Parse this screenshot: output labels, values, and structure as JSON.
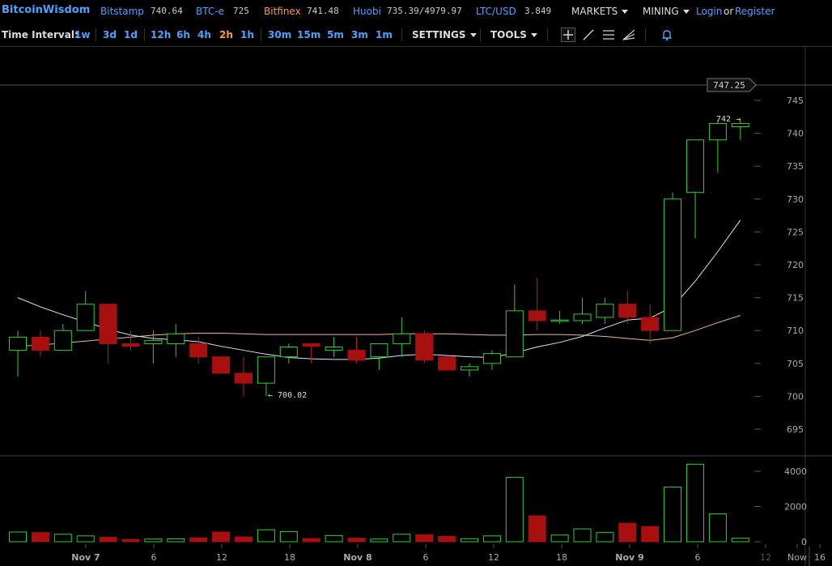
{
  "header": {
    "brand": "BitcoinWisdom",
    "tickers": [
      {
        "name": "Bitstamp",
        "value": "740.64",
        "color": "#4aa3ff"
      },
      {
        "name": "BTC-e",
        "value": "725",
        "color": "#4aa3ff"
      },
      {
        "name": "Bitfinex",
        "value": "741.48",
        "color": "#ff9a3c"
      },
      {
        "name": "Huobi",
        "value": "735.39/4979.97",
        "color": "#4aa3ff"
      },
      {
        "name": "LTC/USD",
        "value": "3.849",
        "color": "#4aa3ff"
      }
    ],
    "markets_label": "MARKETS",
    "mining_label": "MINING",
    "login_label": "Login",
    "or_label": "or",
    "register_label": "Register"
  },
  "toolbar": {
    "time_interval_label": "Time Interval:",
    "intervals": [
      "1w",
      "3d",
      "1d",
      "12h",
      "6h",
      "4h",
      "2h",
      "1h",
      "30m",
      "15m",
      "5m",
      "3m",
      "1m"
    ],
    "active_interval": "2h",
    "settings_label": "SETTINGS",
    "tools_label": "TOOLS",
    "tool_icons": [
      "crosshair-icon",
      "line-draw-icon",
      "fibonacci-icon",
      "fan-icon",
      "alert-bell-icon"
    ]
  },
  "chart_data": {
    "type": "candlestick",
    "price_axis": {
      "ticks": [
        695,
        700,
        705,
        710,
        715,
        720,
        725,
        730,
        735,
        740,
        745
      ],
      "range": [
        692,
        749
      ]
    },
    "volume_axis": {
      "ticks": [
        0,
        2000,
        4000
      ],
      "range": [
        0,
        4600
      ]
    },
    "time_axis": {
      "labels": [
        "Nov 7",
        "6",
        "12",
        "18",
        "Nov 8",
        "6",
        "12",
        "18",
        "Nov 9",
        "6",
        "12",
        "Now",
        "16"
      ]
    },
    "last_price_label": "747.25",
    "last_price": 747.25,
    "high_label": "742 →",
    "low_label": "← 700.02",
    "candles": [
      {
        "o": 707,
        "h": 710,
        "l": 703,
        "c": 709,
        "v": 550
      },
      {
        "o": 709,
        "h": 710,
        "l": 706,
        "c": 707,
        "v": 520
      },
      {
        "o": 707,
        "h": 711,
        "l": 707,
        "c": 710,
        "v": 420
      },
      {
        "o": 710,
        "h": 716,
        "l": 710,
        "c": 714,
        "v": 330
      },
      {
        "o": 714,
        "h": 714,
        "l": 705,
        "c": 708,
        "v": 250
      },
      {
        "o": 708,
        "h": 710,
        "l": 707,
        "c": 707.6,
        "v": 130
      },
      {
        "o": 708,
        "h": 710,
        "l": 705,
        "c": 708.5,
        "v": 150
      },
      {
        "o": 708,
        "h": 711,
        "l": 706,
        "c": 709.5,
        "v": 160
      },
      {
        "o": 708,
        "h": 709,
        "l": 705,
        "c": 706,
        "v": 220
      },
      {
        "o": 706,
        "h": 706,
        "l": 704,
        "c": 703.5,
        "v": 550
      },
      {
        "o": 703.5,
        "h": 706,
        "l": 700,
        "c": 702,
        "v": 270
      },
      {
        "o": 702,
        "h": 706,
        "l": 700,
        "c": 706,
        "v": 680
      },
      {
        "o": 706,
        "h": 708,
        "l": 705,
        "c": 707.5,
        "v": 580
      },
      {
        "o": 708,
        "h": 708,
        "l": 705,
        "c": 707.6,
        "v": 180
      },
      {
        "o": 707,
        "h": 709,
        "l": 706,
        "c": 707.5,
        "v": 350
      },
      {
        "o": 707,
        "h": 709,
        "l": 705,
        "c": 705.5,
        "v": 200
      },
      {
        "o": 706,
        "h": 708,
        "l": 704,
        "c": 708,
        "v": 150
      },
      {
        "o": 708,
        "h": 712,
        "l": 706,
        "c": 709.5,
        "v": 420
      },
      {
        "o": 709.5,
        "h": 710,
        "l": 705,
        "c": 705.5,
        "v": 400
      },
      {
        "o": 706,
        "h": 706,
        "l": 704,
        "c": 704,
        "v": 300
      },
      {
        "o": 704,
        "h": 705,
        "l": 703,
        "c": 704.5,
        "v": 170
      },
      {
        "o": 705,
        "h": 707,
        "l": 704,
        "c": 706.5,
        "v": 330
      },
      {
        "o": 706,
        "h": 717,
        "l": 706,
        "c": 713,
        "v": 3650
      },
      {
        "o": 713,
        "h": 718,
        "l": 710,
        "c": 711.5,
        "v": 1470
      },
      {
        "o": 711.5,
        "h": 713,
        "l": 711,
        "c": 711.6,
        "v": 380
      },
      {
        "o": 711.5,
        "h": 715,
        "l": 711,
        "c": 712.5,
        "v": 730
      },
      {
        "o": 712,
        "h": 715,
        "l": 711,
        "c": 714,
        "v": 520
      },
      {
        "o": 714,
        "h": 716,
        "l": 711,
        "c": 712,
        "v": 1050
      },
      {
        "o": 712,
        "h": 714,
        "l": 708,
        "c": 710,
        "v": 860
      },
      {
        "o": 710,
        "h": 731,
        "l": 710,
        "c": 730,
        "v": 3100
      },
      {
        "o": 731,
        "h": 739,
        "l": 724,
        "c": 739,
        "v": 4400
      },
      {
        "o": 739,
        "h": 742,
        "l": 734,
        "c": 741.5,
        "v": 1580
      },
      {
        "o": 741,
        "h": 742,
        "l": 739,
        "c": 741.5,
        "v": 200
      }
    ],
    "ma_fast": [
      715,
      713.6,
      712.4,
      711.3,
      710.2,
      709.3,
      708.8,
      708.6,
      708.3,
      707.6,
      707,
      706.4,
      705.9,
      705.7,
      705.6,
      705.6,
      705.8,
      706.2,
      706.4,
      706.2,
      706,
      705.9,
      706.6,
      707.5,
      708.2,
      709.1,
      710.4,
      711.6,
      711.9,
      713.6,
      717.5,
      722,
      726.8
    ],
    "ma_slow": [
      707.6,
      707.8,
      708.1,
      708.4,
      708.7,
      709,
      709.3,
      709.5,
      709.6,
      709.6,
      709.5,
      709.4,
      709.4,
      709.4,
      709.4,
      709.4,
      709.4,
      709.5,
      709.5,
      709.5,
      709.4,
      709.3,
      709.3,
      709.4,
      709.4,
      709.3,
      709.1,
      708.8,
      708.5,
      708.9,
      710,
      711.2,
      712.3
    ],
    "colors": {
      "up": "#2fcf2f",
      "down": "#a80f0f",
      "ma_fast": "#d8e8ff",
      "ma_slow": "#f0b890",
      "grid": "#2e2e2e",
      "axis_text": "#aaaaaa"
    }
  }
}
